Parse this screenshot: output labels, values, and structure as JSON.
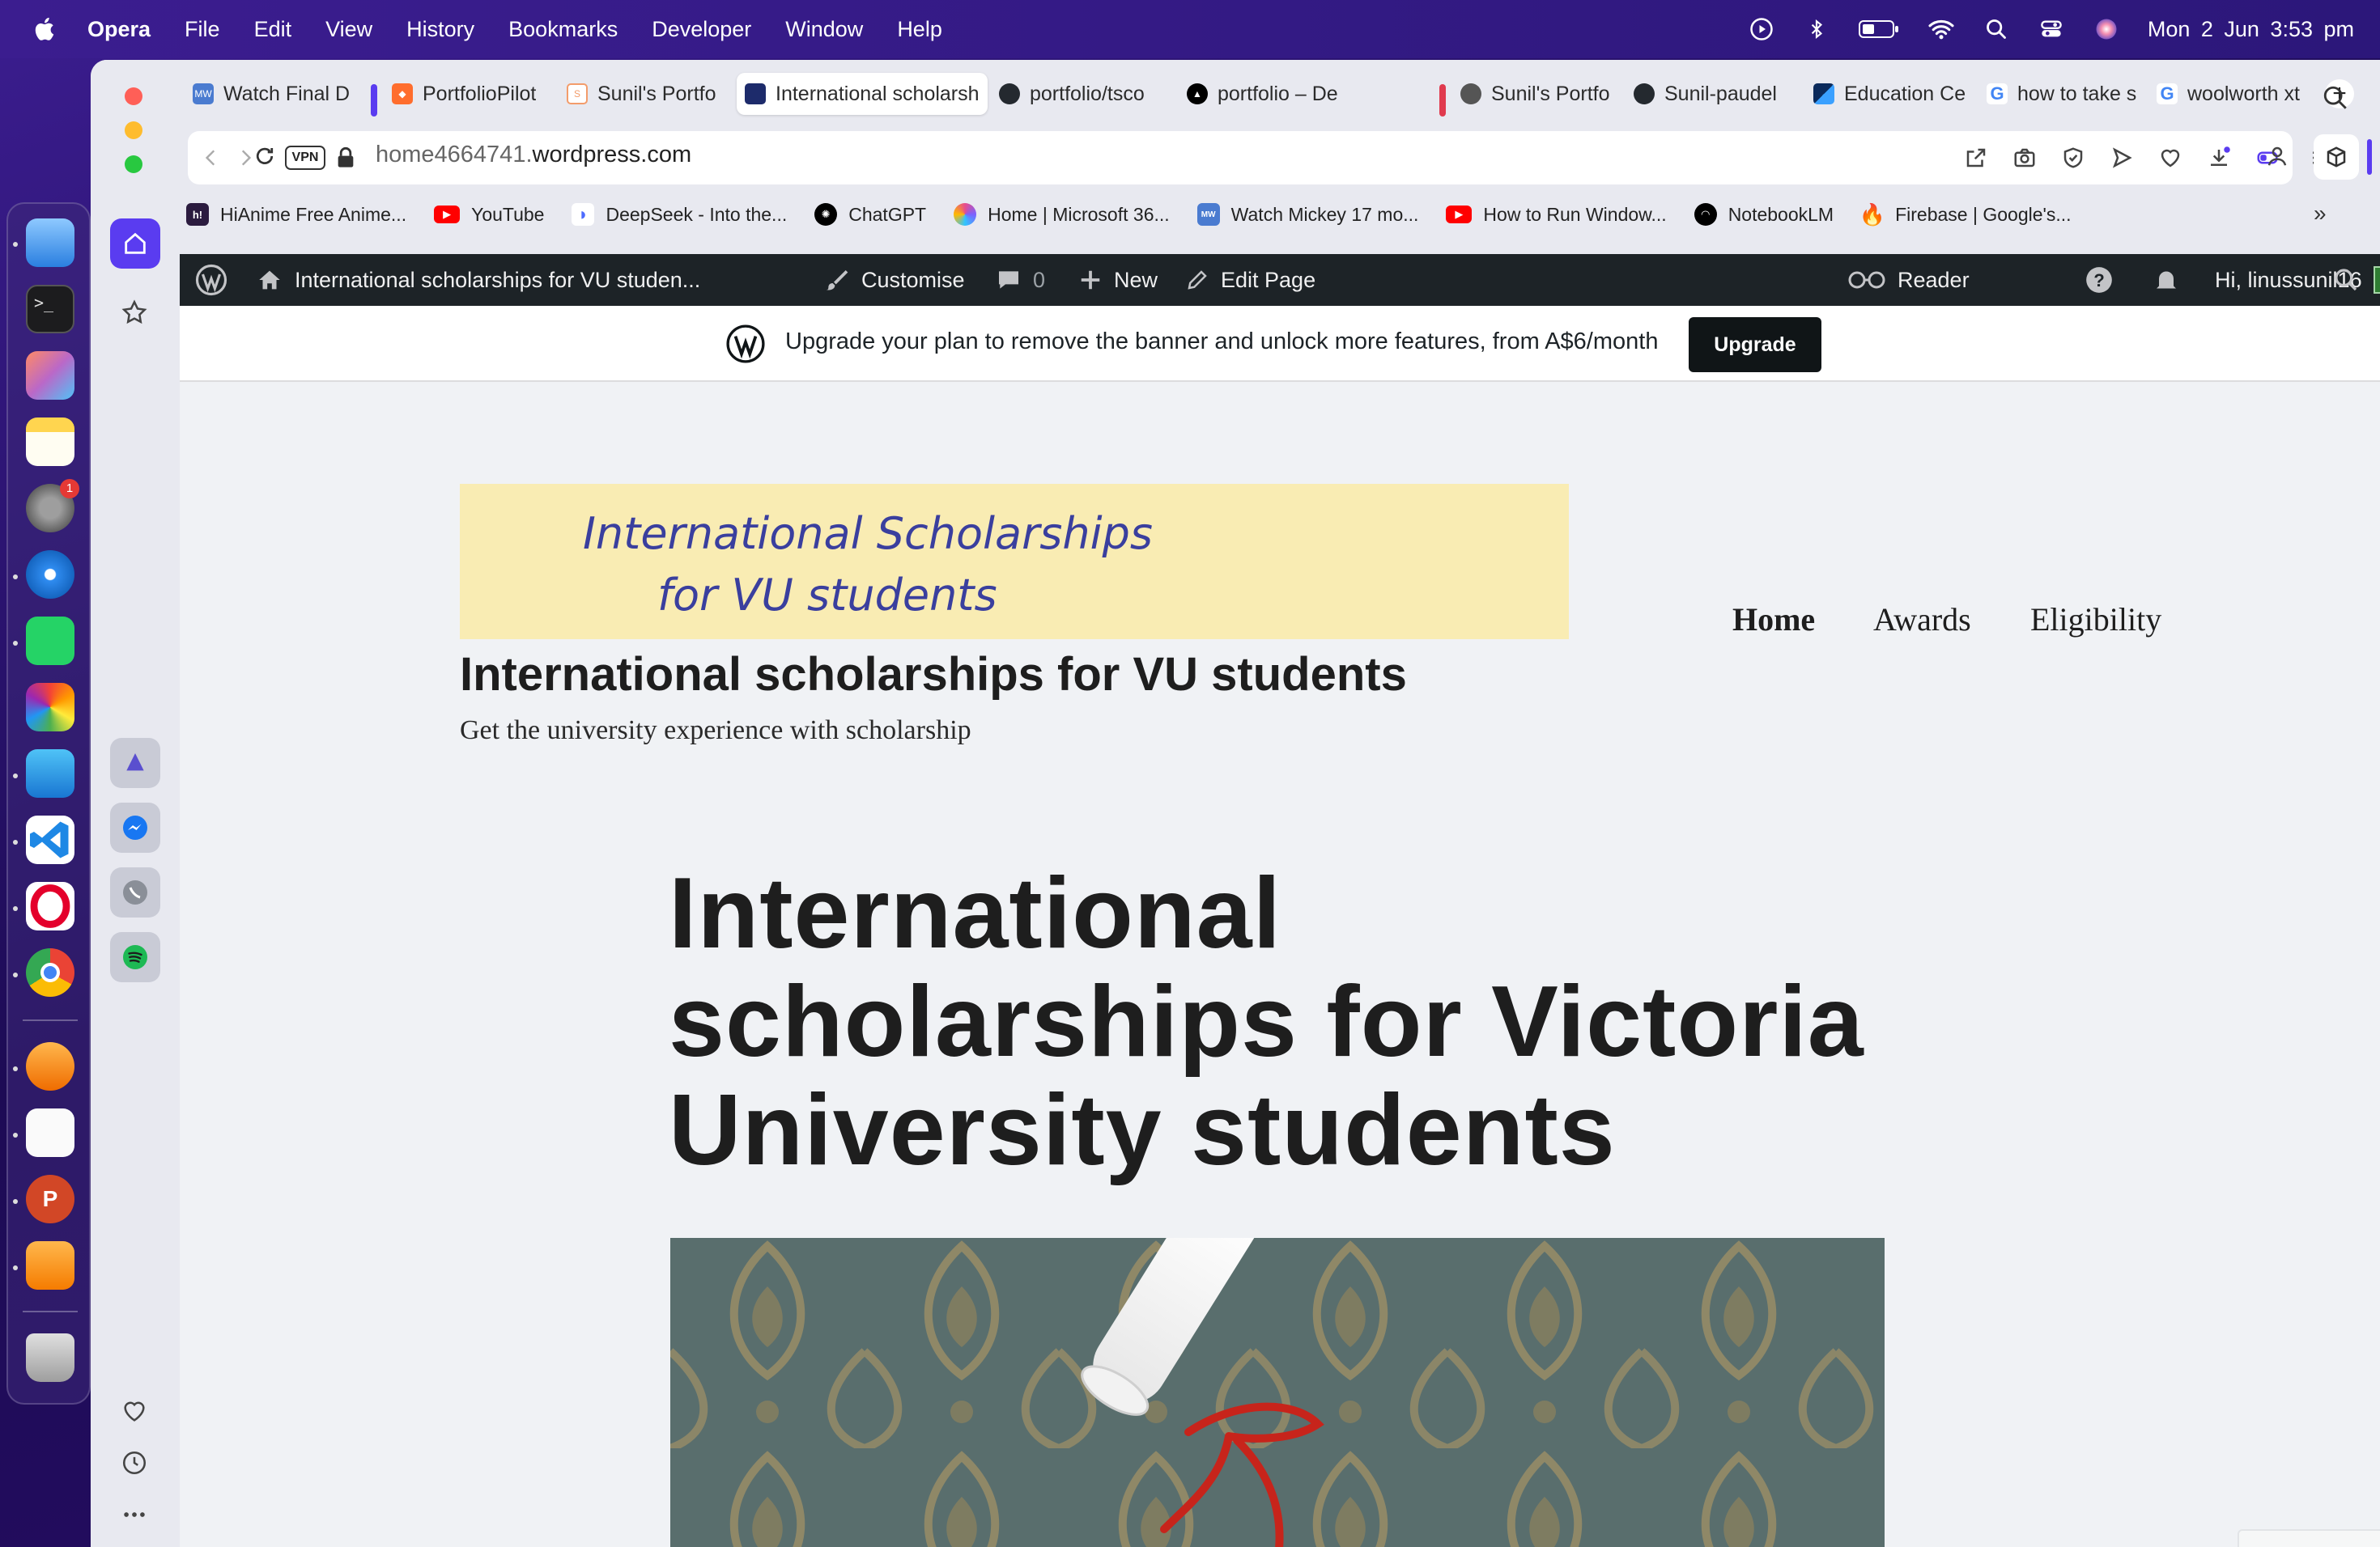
{
  "menubar": {
    "app": "Opera",
    "items": [
      "File",
      "Edit",
      "View",
      "History",
      "Bookmarks",
      "Developer",
      "Window",
      "Help"
    ],
    "clock": "Mon 2 Jun  3:53 pm"
  },
  "dock": {
    "apps": [
      "Finder",
      "Terminal",
      "Launchpad",
      "Notes",
      "System Settings",
      "Safari",
      "WhatsApp",
      "Photos",
      "Mail",
      "Visual Studio Code",
      "Opera",
      "Google Chrome",
      "Magnet",
      "TextEdit",
      "Microsoft PowerPoint",
      "Pages",
      "Trash"
    ],
    "settings_badge": "1"
  },
  "tabs": [
    {
      "label": "Watch Final D"
    },
    {
      "label": "PortfolioPilot"
    },
    {
      "label": "Sunil's Portfo"
    },
    {
      "label": "International scholarsh"
    },
    {
      "label": "portfolio/tsco"
    },
    {
      "label": "portfolio – De"
    },
    {
      "label": "Sunil's Portfo"
    },
    {
      "label": "Sunil-paudel"
    },
    {
      "label": "Education Ce"
    },
    {
      "label": "how to take s"
    },
    {
      "label": "woolworth xt"
    }
  ],
  "address": {
    "vpn": "VPN",
    "url_prefix": "home4664741.",
    "url_domain": "wordpress.com"
  },
  "bookmarks": [
    {
      "label": "HiAnime Free Anime..."
    },
    {
      "label": "YouTube"
    },
    {
      "label": "DeepSeek - Into the..."
    },
    {
      "label": "ChatGPT"
    },
    {
      "label": "Home | Microsoft 36..."
    },
    {
      "label": "Watch Mickey 17 mo..."
    },
    {
      "label": "How to Run Window..."
    },
    {
      "label": "NotebookLM"
    },
    {
      "label": "Firebase | Google's..."
    }
  ],
  "wp_admin_bar": {
    "site_name": "International scholarships for VU studen...",
    "customise": "Customise",
    "comments_count": "0",
    "new": "New",
    "edit_page": "Edit Page",
    "reader": "Reader",
    "greeting": "Hi, linussunil16"
  },
  "banner": {
    "text": "Upgrade your plan to remove the banner and unlock more features, from A$6/month",
    "button": "Upgrade"
  },
  "site": {
    "logo_line1": "International Scholarships",
    "logo_line2": "for VU students",
    "title": "International scholarships for VU students",
    "tagline": "Get the university experience with scholarship",
    "nav": [
      "Home",
      "Awards",
      "Eligibility"
    ],
    "page_heading": "International scholarships for Victoria University students"
  },
  "colors": {
    "menubar": "#3b1d8f",
    "wp_bar": "#1d2327",
    "logo_bg": "#f9ecb3",
    "logo_text": "#3a3f9e",
    "page_bg": "#f0f2f5"
  }
}
